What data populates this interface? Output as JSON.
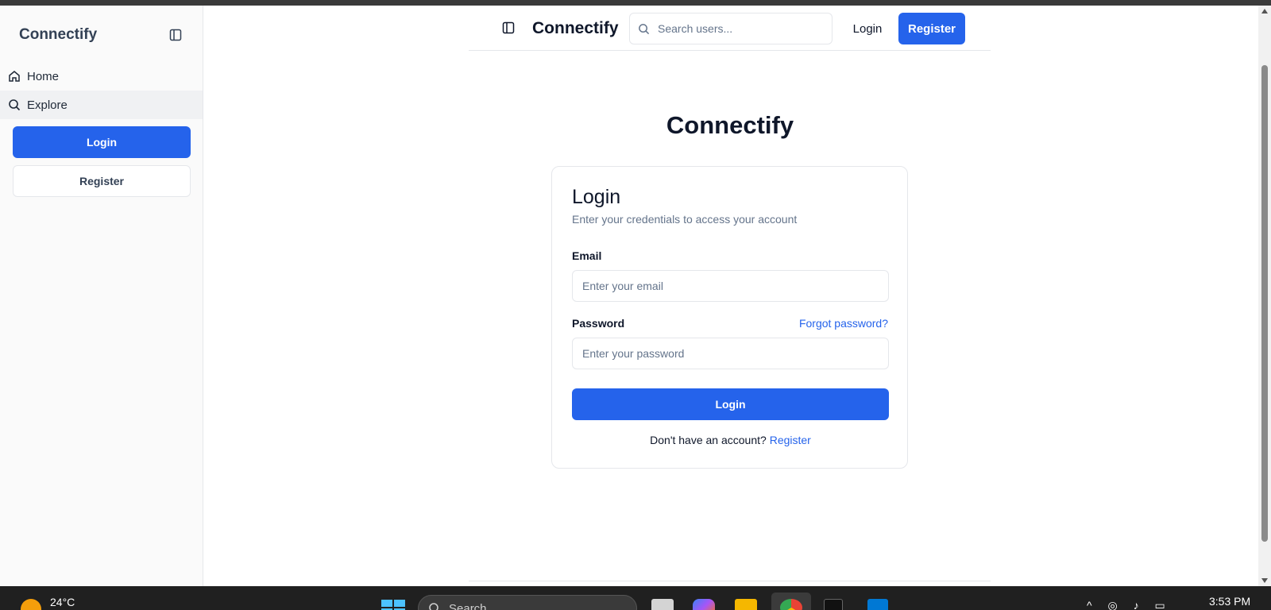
{
  "sidebar": {
    "brand": "Connectify",
    "items": [
      {
        "label": "Home",
        "icon": "home-icon"
      },
      {
        "label": "Explore",
        "icon": "search-icon",
        "active": true
      }
    ],
    "login_label": "Login",
    "register_label": "Register"
  },
  "navbar": {
    "brand": "Connectify",
    "search_placeholder": "Search users...",
    "login_label": "Login",
    "register_label": "Register"
  },
  "main": {
    "title": "Connectify",
    "card": {
      "title": "Login",
      "subtitle": "Enter your credentials to access your account",
      "email_label": "Email",
      "email_placeholder": "Enter your email",
      "password_label": "Password",
      "forgot_label": "Forgot password?",
      "password_placeholder": "Enter your password",
      "submit_label": "Login",
      "footer_text": "Don't have an account?",
      "footer_link": "Register"
    }
  },
  "taskbar": {
    "temperature": "24°C",
    "search_label": "Search",
    "time": "3:53 PM"
  },
  "colors": {
    "accent": "#2563eb",
    "text": "#0f172a",
    "muted": "#64748b",
    "border": "#e5e7eb"
  }
}
